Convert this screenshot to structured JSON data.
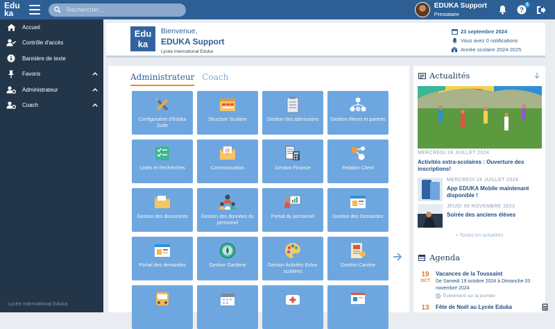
{
  "topbar": {
    "logo_line1": "Edu",
    "logo_line2": "ka",
    "search_placeholder": "Rechercher...",
    "user_name": "EDUKA Support",
    "user_role": "Prestataire",
    "help_badge": "5",
    "accent": "#2d5f95"
  },
  "sidebar": {
    "items": [
      {
        "label": "Accueil",
        "icon": "home-icon"
      },
      {
        "label": "Contrôle d'accès",
        "icon": "user-check-icon"
      },
      {
        "label": "Bannière de texte",
        "icon": "info-icon"
      },
      {
        "label": "Favoris",
        "icon": "pin-icon"
      },
      {
        "label": "Administrateur",
        "icon": "user-gear-icon"
      },
      {
        "label": "Coach",
        "icon": "user-gear-icon"
      }
    ],
    "footer": "Lycée International Eduka"
  },
  "welcome": {
    "brand_line1": "Edu",
    "brand_line2": "ka",
    "greeting": "Bienvenue,",
    "name": "EDUKA Support",
    "school": "Lycée International Eduka",
    "date": "23 septembre 2024",
    "notifications": "Vous avez 0 notifications",
    "school_year": "Année scolaire 2024-2025"
  },
  "modules": {
    "tabs": [
      "Administrateur",
      "Coach"
    ],
    "tiles": [
      {
        "label": "Configuration d'Eduka Suite",
        "icon": "tools-icon"
      },
      {
        "label": "Structure Scolaire",
        "icon": "layout-icon"
      },
      {
        "label": "Gestion des admissions",
        "icon": "clipboard-icon"
      },
      {
        "label": "Gestion élèves et parents",
        "icon": "people-network-icon"
      },
      {
        "label": "Listes et Recherches",
        "icon": "checklist-icon"
      },
      {
        "label": "Communication",
        "icon": "envelope-icon"
      },
      {
        "label": "Gestion Finance",
        "icon": "calculator-icon"
      },
      {
        "label": "Relation Client",
        "icon": "nodes-icon"
      },
      {
        "label": "Gestion des documents",
        "icon": "folder-icon"
      },
      {
        "label": "Gestion des données du personnel",
        "icon": "staff-icon"
      },
      {
        "label": "Portail du personnel",
        "icon": "presentation-icon"
      },
      {
        "label": "Gestion des Demandes",
        "icon": "window-icon"
      },
      {
        "label": "Portail des demandes",
        "icon": "window-icon"
      },
      {
        "label": "Gestion Garderie",
        "icon": "compass-icon"
      },
      {
        "label": "Gestion Activités Extra-scolaires",
        "icon": "palette-icon"
      },
      {
        "label": "Gestion Cantine",
        "icon": "menu-card-icon"
      },
      {
        "label": "",
        "icon": "bus-icon"
      },
      {
        "label": "",
        "icon": "calendar-icon"
      },
      {
        "label": "",
        "icon": "medical-icon"
      },
      {
        "label": "",
        "icon": "board-icon"
      }
    ]
  },
  "news": {
    "title": "Actualités",
    "items": [
      {
        "date": "MERCREDI 24 JUILLET 2024",
        "title": "Activités extra-scolaires : Ouverture des inscriptions!"
      },
      {
        "date": "MERCREDI 24 JUILLET 2024",
        "title": "App EDUKA Mobile maintenant disponible !"
      },
      {
        "date": "JEUDI 09 NOVEMBRE 2023",
        "title": "Soirée des anciens élèves"
      }
    ],
    "all_link": "« Toutes les actualités"
  },
  "agenda": {
    "title": "Agenda",
    "items": [
      {
        "day": "19",
        "month": "OCT",
        "title": "Vacances de la Toussaint",
        "desc": "De Samedi 19 octobre 2024 à Dimanche 03 novembre 2024",
        "type": "Événement sur la journée"
      },
      {
        "day": "13",
        "month": "",
        "title": "Fête de Noël au Lycée Eduka",
        "desc": "",
        "type": ""
      }
    ]
  }
}
